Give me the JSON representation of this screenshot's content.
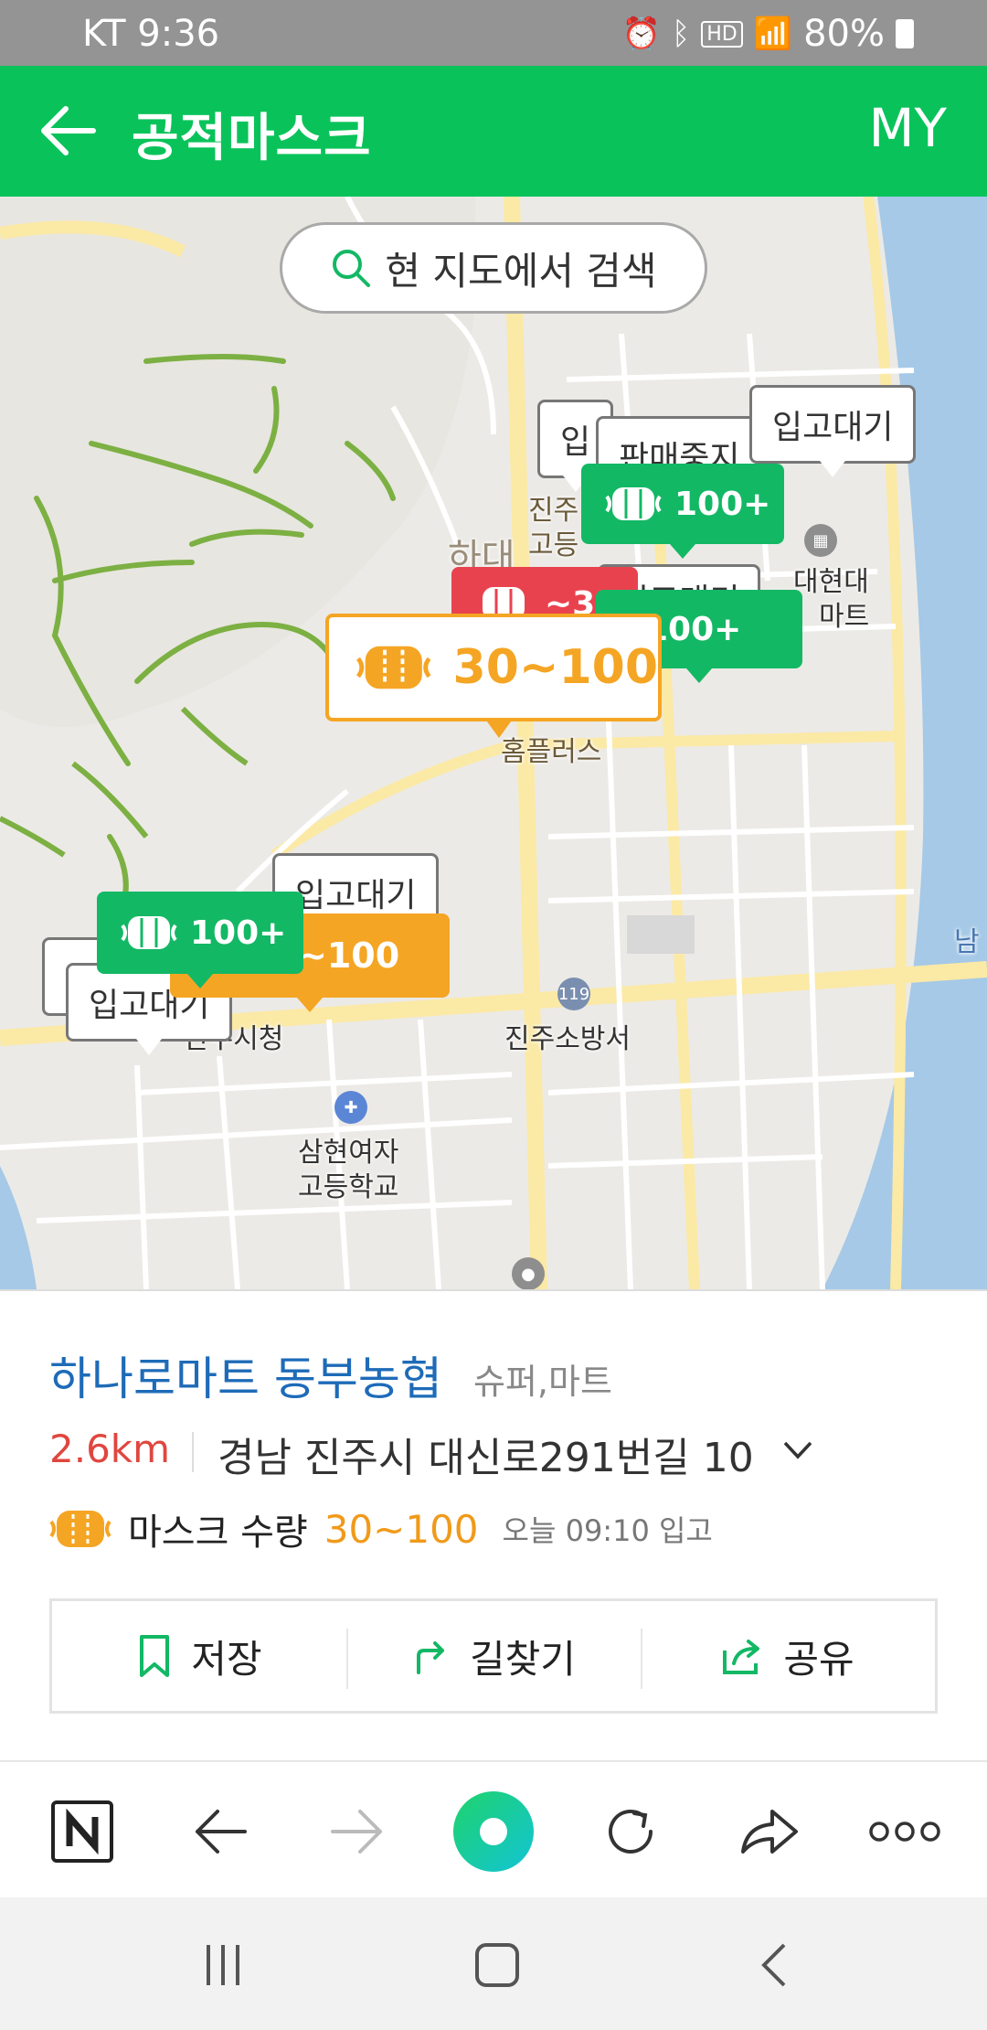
{
  "status_bar": {
    "carrier_time": "KT 9:36",
    "battery": "80%"
  },
  "app_bar": {
    "title": "공적마스크",
    "my_label": "MY"
  },
  "map": {
    "search_button": "현 지도에서 검색",
    "place_labels": [
      "진주",
      "고등",
      "하대",
      "대현대",
      "마트",
      "홈플러스",
      "진주소방서",
      "삼현여자",
      "고등학교",
      "남",
      "진주시청"
    ],
    "status_callouts": [
      "입고대기",
      "판매중지",
      "입",
      "입고대기",
      "입고대기",
      "입",
      "입고대기"
    ],
    "badges": [
      {
        "level": "green",
        "label": "100+"
      },
      {
        "level": "green",
        "label": "100+"
      },
      {
        "level": "red",
        "label": "~3"
      },
      {
        "level": "green",
        "label": "100+"
      },
      {
        "level": "orange",
        "label": "~100"
      }
    ],
    "selected_badge": "30~100"
  },
  "store": {
    "name": "하나로마트 동부농협",
    "category": "슈퍼,마트",
    "distance": "2.6km",
    "address": "경남 진주시 대신로291번길 10",
    "mask_label": "마스크 수량",
    "mask_qty": "30~100",
    "restock_time": "오늘 09:10 입고"
  },
  "actions": {
    "save": "저장",
    "directions": "길찾기",
    "share": "공유"
  },
  "colors": {
    "brand_green": "#09c35a",
    "badge_green": "#13b865",
    "badge_red": "#e9424f",
    "badge_orange": "#f5a524",
    "link_blue": "#1e6bb8"
  },
  "icons": [
    "back-arrow-icon",
    "search-icon",
    "mask-icon",
    "bookmark-icon",
    "directions-icon",
    "share-icon",
    "naver-logo-icon",
    "browser-back-icon",
    "browser-forward-icon",
    "green-dot-icon",
    "refresh-icon",
    "browser-share-icon",
    "more-icon"
  ]
}
